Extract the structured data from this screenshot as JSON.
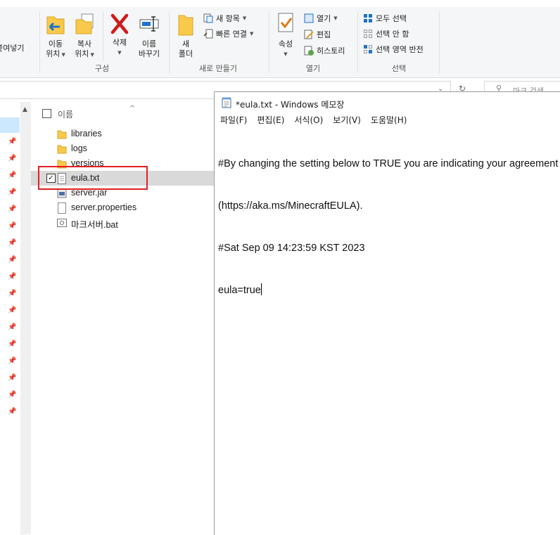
{
  "ribbon": {
    "cut_label": "붙여넣기",
    "move_to_label": "이동\n위치",
    "copy_to_label": "복사\n위치",
    "delete_label": "삭제",
    "rename_label": "이름\n바꾸기",
    "organize_group": "구성",
    "new_folder_label": "새\n폴더",
    "new_item_label": "새 항목",
    "easy_access_label": "빠른 연결",
    "new_group": "새로 만들기",
    "properties_label": "속성",
    "open_label": "열기",
    "edit_label": "편집",
    "history_label": "히스토리",
    "open_group": "열기",
    "select_all_label": "모두 선택",
    "select_none_label": "선택 안 함",
    "invert_selection_label": "선택 영역 반전",
    "select_group": "선택"
  },
  "search": {
    "placeholder": "마크 검색"
  },
  "file_list": {
    "column_name": "이름",
    "items": [
      {
        "name": "libraries",
        "type": "folder"
      },
      {
        "name": "logs",
        "type": "folder"
      },
      {
        "name": "versions",
        "type": "folder"
      },
      {
        "name": "eula.txt",
        "type": "text",
        "checked": true,
        "selected": true
      },
      {
        "name": "server.jar",
        "type": "jar"
      },
      {
        "name": "server.properties",
        "type": "file"
      },
      {
        "name": "마크서버.bat",
        "type": "bat"
      }
    ]
  },
  "notepad": {
    "title": "*eula.txt - Windows 메모장",
    "menu": [
      "파일(F)",
      "편집(E)",
      "서식(O)",
      "보기(V)",
      "도움말(H)"
    ],
    "lines": [
      "#By changing the setting below to TRUE you are indicating your agreement",
      "(https://aka.ms/MinecraftEULA).",
      "#Sat Sep 09 14:23:59 KST 2023",
      "eula=true"
    ]
  },
  "colors": {
    "selection_highlight": "#e21e1e",
    "folder": "#f8c94a",
    "delete_x": "#d01b1b",
    "accent_blue": "#1e73c8"
  }
}
